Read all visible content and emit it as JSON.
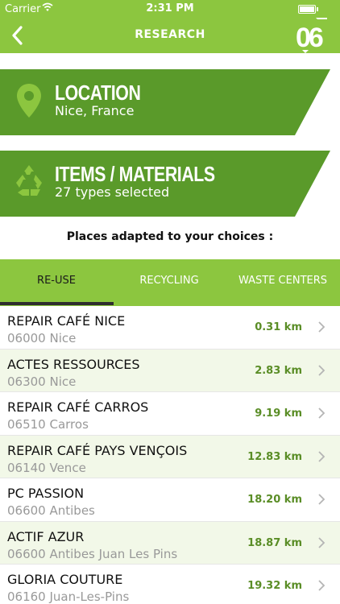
{
  "status_bar": {
    "carrier": "Carrier",
    "time": "2:31 PM"
  },
  "header": {
    "title": "RESEARCH",
    "logo_text": "06"
  },
  "location_card": {
    "title": "LOCATION",
    "value": "Nice, France",
    "icon": "map-pin-icon"
  },
  "items_card": {
    "title": "ITEMS / MATERIALS",
    "value": "27 types selected",
    "icon": "recycle-icon"
  },
  "subtitle": "Places adapted to your choices :",
  "tabs": [
    {
      "label": "RE-USE",
      "active": true
    },
    {
      "label": "RECYCLING",
      "active": false
    },
    {
      "label": "WASTE CENTERS",
      "active": false
    }
  ],
  "places": [
    {
      "name": "REPAIR CAFÉ NICE",
      "address": "06000 Nice",
      "distance": "0.31 km"
    },
    {
      "name": "ACTES RESSOURCES",
      "address": "06300 Nice",
      "distance": "2.83 km"
    },
    {
      "name": "REPAIR CAFÉ CARROS",
      "address": "06510 Carros",
      "distance": "9.19 km"
    },
    {
      "name": "REPAIR CAFÉ PAYS VENÇOIS",
      "address": "06140 Vence",
      "distance": "12.83 km"
    },
    {
      "name": "PC PASSION",
      "address": "06600 Antibes",
      "distance": "18.20 km"
    },
    {
      "name": "ACTIF AZUR",
      "address": "06600 Antibes Juan Les Pins",
      "distance": "18.87 km"
    },
    {
      "name": "GLORIA COUTURE",
      "address": "06160 Juan-Les-Pins",
      "distance": "19.32 km"
    }
  ],
  "colors": {
    "accent": "#8cc63f",
    "card_green": "#5a9a2a",
    "distance_green": "#5a8d26",
    "row_alt": "#f2f8e8"
  }
}
